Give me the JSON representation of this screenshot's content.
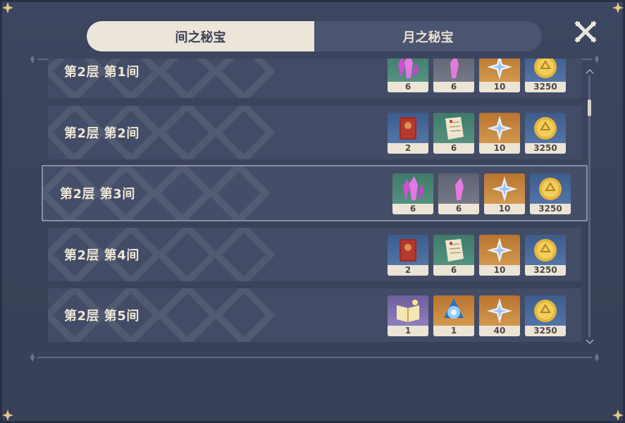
{
  "tabs": [
    {
      "label": "间之秘宝",
      "active": true
    },
    {
      "label": "月之秘宝",
      "active": false
    }
  ],
  "rows": [
    {
      "label": "第2层 第1间",
      "items": [
        {
          "icon": "crystal-pink-icon",
          "count": "6"
        },
        {
          "icon": "crystal-grey-icon",
          "count": "6"
        },
        {
          "icon": "primogem-icon",
          "count": "10"
        },
        {
          "icon": "mora-coin-icon",
          "count": "3250"
        }
      ]
    },
    {
      "label": "第2层 第2间",
      "items": [
        {
          "icon": "red-book-icon",
          "count": "2"
        },
        {
          "icon": "scroll-note-icon",
          "count": "6"
        },
        {
          "icon": "primogem-icon",
          "count": "10"
        },
        {
          "icon": "mora-coin-icon",
          "count": "3250"
        }
      ]
    },
    {
      "label": "第2层 第3间",
      "selected": true,
      "items": [
        {
          "icon": "crystal-pink-icon",
          "count": "6"
        },
        {
          "icon": "crystal-grey-icon",
          "count": "6"
        },
        {
          "icon": "primogem-icon",
          "count": "10"
        },
        {
          "icon": "mora-coin-icon",
          "count": "3250"
        }
      ]
    },
    {
      "label": "第2层 第4间",
      "items": [
        {
          "icon": "red-book-icon",
          "count": "2"
        },
        {
          "icon": "scroll-note-icon",
          "count": "6"
        },
        {
          "icon": "primogem-icon",
          "count": "10"
        },
        {
          "icon": "mora-coin-icon",
          "count": "3250"
        }
      ]
    },
    {
      "label": "第2层 第5间",
      "items": [
        {
          "icon": "golden-book-icon",
          "count": "1"
        },
        {
          "icon": "blue-orb-icon",
          "count": "1"
        },
        {
          "icon": "primogem-icon",
          "count": "40"
        },
        {
          "icon": "mora-coin-icon",
          "count": "3250"
        }
      ]
    }
  ],
  "colors": {
    "panel": "#3d4660",
    "tab_active_bg": "#ece5da",
    "tab_inactive_bg": "#4b5470",
    "row_bg": "#434c66",
    "accent_gold": "#e8c35a"
  },
  "scroll": {
    "position": 0.08
  }
}
